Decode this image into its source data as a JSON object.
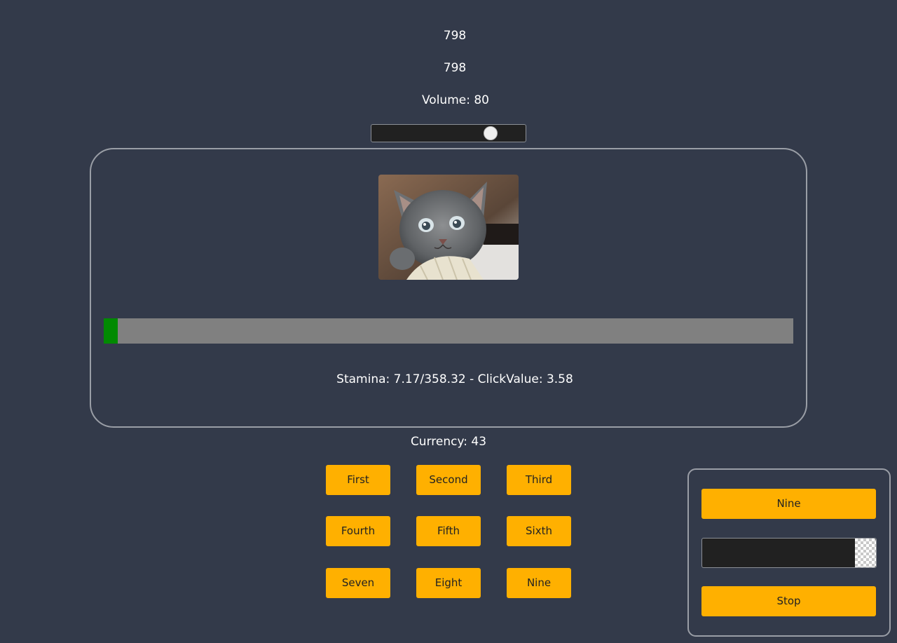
{
  "counters": {
    "value_1": "798",
    "value_2": "798"
  },
  "volume": {
    "label": "Volume: 80",
    "value": 80,
    "min": 0,
    "max": 100
  },
  "game": {
    "image_alt": "kitten-image",
    "stamina_current": 7.17,
    "stamina_max": 358.32,
    "stamina_text": "Stamina: 7.17/358.32 - ClickValue: 3.58",
    "stamina_fill_color": "#018a01"
  },
  "currency": {
    "label": "Currency: 43"
  },
  "buttons": [
    {
      "label": "First"
    },
    {
      "label": "Second"
    },
    {
      "label": "Third"
    },
    {
      "label": "Fourth"
    },
    {
      "label": "Fifth"
    },
    {
      "label": "Sixth"
    },
    {
      "label": "Seven"
    },
    {
      "label": "Eight"
    },
    {
      "label": "Nine"
    }
  ],
  "side_panel": {
    "top_button_label": "Nine",
    "input_value": "",
    "stop_button_label": "Stop"
  },
  "colors": {
    "background": "#333a4a",
    "accent": "#ffb000"
  }
}
